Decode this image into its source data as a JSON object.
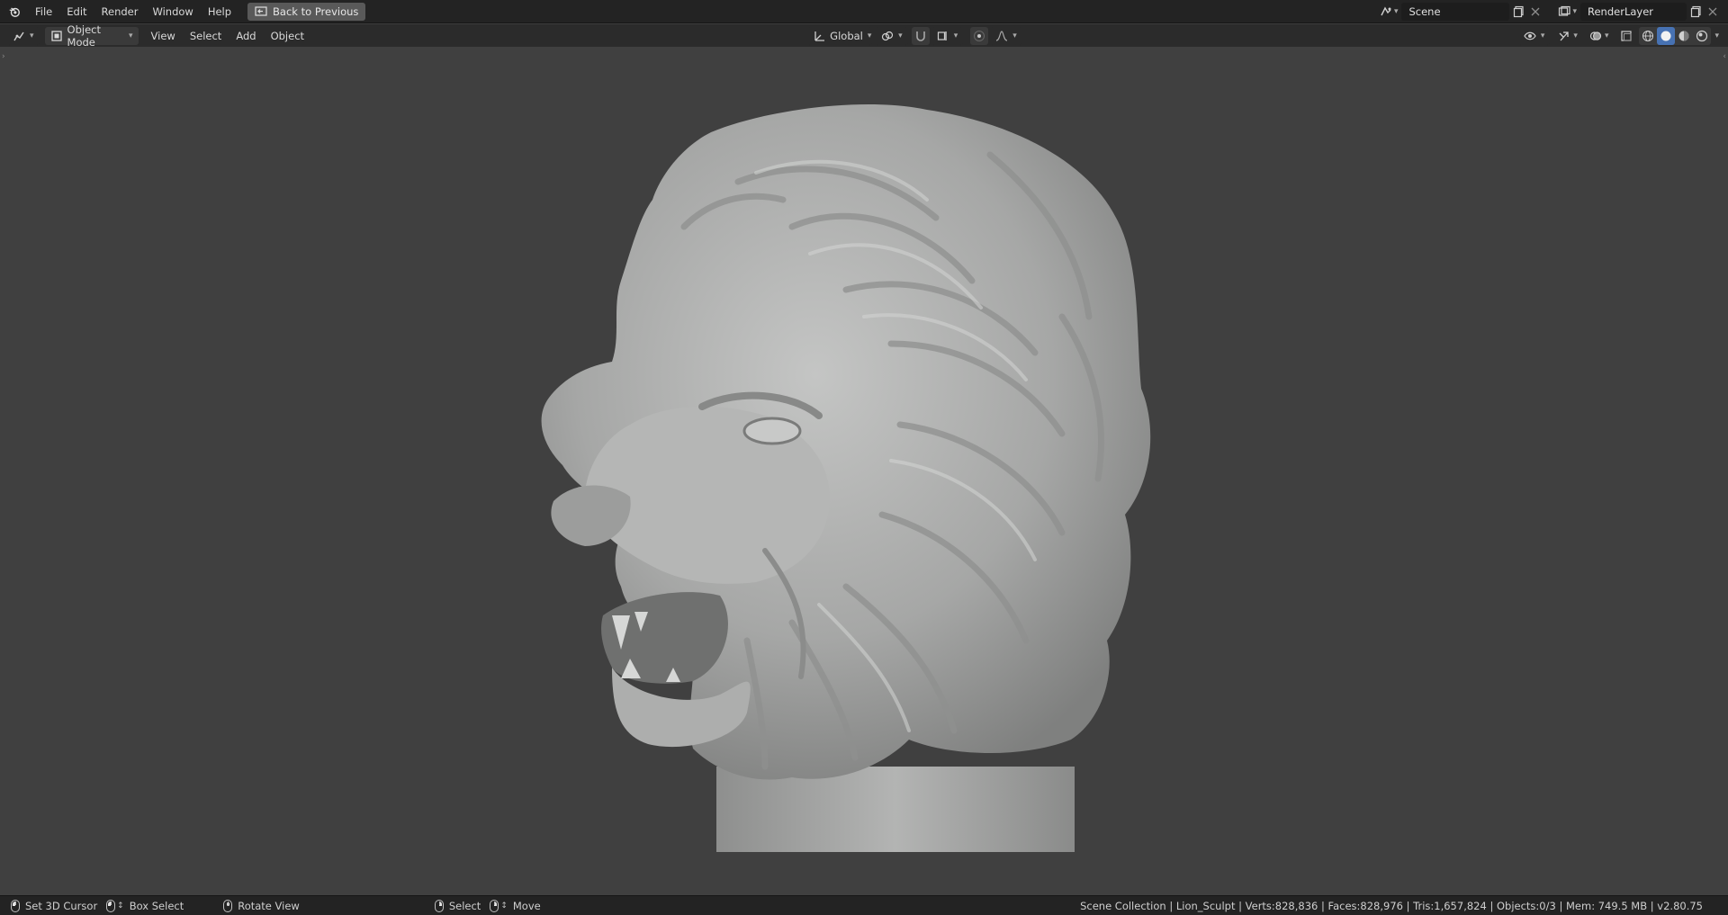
{
  "topbar": {
    "menus": [
      "File",
      "Edit",
      "Render",
      "Window",
      "Help"
    ],
    "back_button": "Back to Previous",
    "scene_name": "Scene",
    "view_layer_name": "RenderLayer"
  },
  "header": {
    "mode": "Object Mode",
    "menus": [
      "View",
      "Select",
      "Add",
      "Object"
    ],
    "transform_orientation": "Global"
  },
  "statusbar": {
    "hints": {
      "set_cursor": "Set 3D Cursor",
      "box_select": "Box Select",
      "rotate_view": "Rotate View",
      "select": "Select",
      "move": "Move"
    },
    "scene_stats": "Scene Collection | Lion_Sculpt | Verts:828,836 | Faces:828,976 | Tris:1,657,824 | Objects:0/3 | Mem: 749.5 MB | v2.80.75"
  },
  "colors": {
    "accent": "#4772b3",
    "viewport_bg": "#404040",
    "bar_bg": "#232323",
    "model_surface": "#a9aaa9"
  },
  "icons": [
    "blender-logo-icon",
    "back-arrow-icon",
    "editor-type-icon",
    "object-mode-icon",
    "transform-orientation-icon",
    "pivot-icon",
    "snap-icon",
    "proportional-edit-icon",
    "visibility-icon",
    "gizmo-icon",
    "overlay-icon",
    "xray-icon",
    "shading-wireframe-icon",
    "shading-solid-icon",
    "shading-material-icon",
    "shading-rendered-icon"
  ]
}
